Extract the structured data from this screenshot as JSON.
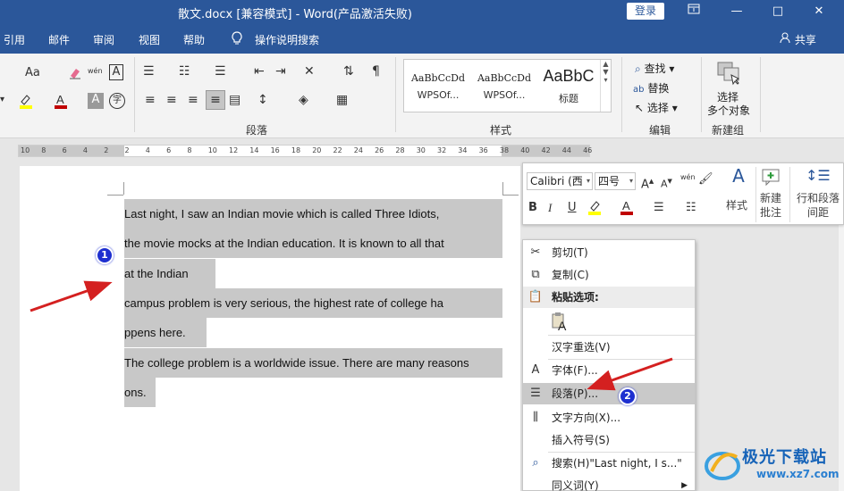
{
  "window": {
    "title": "散文.docx [兼容模式]  -  Word(产品激活失败)",
    "login_label": "登录",
    "controls": {
      "restore_icon": "ribbon-display-icon",
      "minimize": "—",
      "maximize": "□",
      "close": "✕"
    }
  },
  "menu": {
    "tabs": [
      "引用",
      "邮件",
      "审阅",
      "视图",
      "帮助"
    ],
    "search_label": "操作说明搜索",
    "share_label": "共享"
  },
  "ribbon": {
    "paragraph_group_label": "段落",
    "styles_group_label": "样式",
    "edit_group_label": "编辑",
    "new_group_label": "新建组",
    "styles": [
      {
        "sample": "AaBbCcDd",
        "name": "WPSOf..."
      },
      {
        "sample": "AaBbCcDd",
        "name": "WPSOf..."
      },
      {
        "sample": "AaBbC",
        "name": "标题"
      }
    ],
    "find_label": "查找",
    "replace_label": "替换",
    "select_label": "选择",
    "select_objects_label_1": "选择",
    "select_objects_label_2": "多个对象",
    "font_size_glyph": "Aa",
    "wen_glyph": "wén",
    "font_color_glyph": "A",
    "circled_char": "字"
  },
  "ruler": {
    "labels": [
      "10",
      "8",
      "6",
      "4",
      "2",
      "2",
      "4",
      "6",
      "8",
      "10",
      "12",
      "14",
      "16",
      "18",
      "20",
      "22",
      "24",
      "26",
      "28",
      "30",
      "32",
      "34",
      "36",
      "38",
      "40",
      "42",
      "44",
      "46"
    ]
  },
  "document": {
    "lines": [
      "Last  night,  I  saw  an  Indian  movie  which  is  called  Three  Idiots,",
      "the  movie  mocks  at  the  Indian  education.  It  is  known  to  all  that",
      "at  the  Indian",
      "campus  problem  is  very  serious,  the  highest  rate  of  college  ha",
      "ppens  here.",
      "The  college  problem  is  a  worldwide  issue.  There  are  many  reasons",
      "ons."
    ]
  },
  "mini_toolbar": {
    "font_name": "Calibri (西",
    "font_size": "四号",
    "bold": "B",
    "italic": "I",
    "underline": "U",
    "styles_label": "样式",
    "new_comment_label_1": "新建",
    "new_comment_label_2": "批注",
    "line_spacing_label_1": "行和段落",
    "line_spacing_label_2": "间距"
  },
  "context_menu": {
    "items": [
      {
        "label": "剪切(T)",
        "icon": "scissors-icon"
      },
      {
        "label": "复制(C)",
        "icon": "copy-icon"
      },
      {
        "label": "粘贴选项:",
        "icon": "paste-icon"
      },
      {
        "label": "",
        "icon": "paste-text-only-icon"
      },
      {
        "label": "汉字重选(V)",
        "icon": ""
      },
      {
        "label": "字体(F)...",
        "icon": "font-icon"
      },
      {
        "label": "段落(P)...",
        "icon": "paragraph-icon"
      },
      {
        "label": "文字方向(X)...",
        "icon": "text-direction-icon"
      },
      {
        "label": "插入符号(S)",
        "icon": ""
      },
      {
        "label": "搜索(H)\"Last night, I s...\"",
        "icon": "search-icon"
      },
      {
        "label": "同义词(Y)",
        "icon": ""
      }
    ]
  },
  "annotations": {
    "badge1": "1",
    "badge2": "2",
    "arrow_color": "#d42020"
  },
  "watermark": {
    "text1": "极光下载站",
    "text2": "www.xz7.com"
  },
  "colors": {
    "title_bar": "#2b579a",
    "selection": "#c8c8c8",
    "highlight_menu": "#c9c9c9",
    "font_color_red": "#c00000",
    "highlight_yellow": "#ffff00"
  }
}
